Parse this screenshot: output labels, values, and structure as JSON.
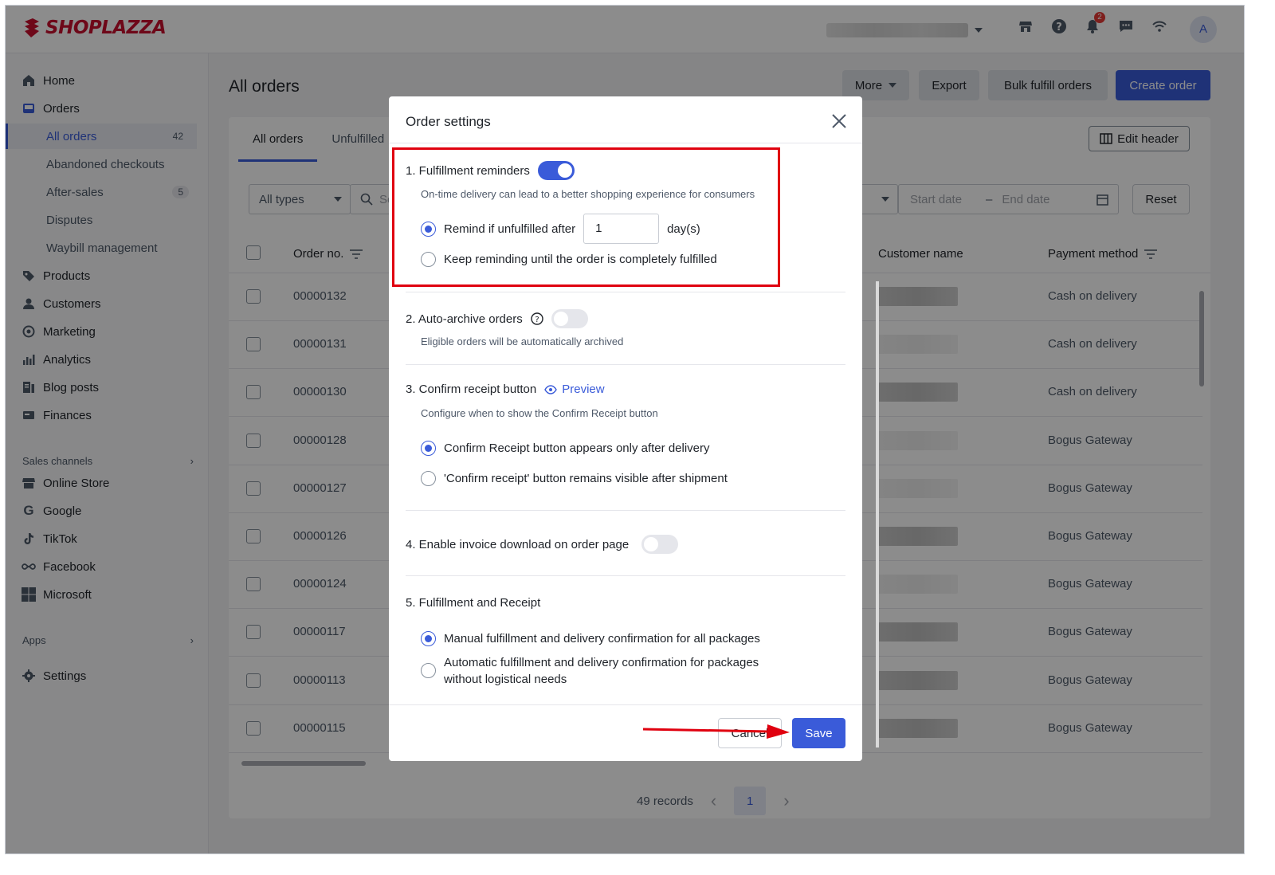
{
  "brand": {
    "name": "SHOPLAZZA",
    "color": "#c8102e"
  },
  "topbar": {
    "notification_count": "2",
    "avatar_initial": "A"
  },
  "sidebar": {
    "items": [
      {
        "label": "Home",
        "icon": "home-icon"
      },
      {
        "label": "Orders",
        "icon": "orders-icon"
      },
      {
        "label": "Products",
        "icon": "tag-icon"
      },
      {
        "label": "Customers",
        "icon": "person-icon"
      },
      {
        "label": "Marketing",
        "icon": "marketing-icon"
      },
      {
        "label": "Analytics",
        "icon": "bar-chart-icon"
      },
      {
        "label": "Blog posts",
        "icon": "blog-icon"
      },
      {
        "label": "Finances",
        "icon": "finances-icon"
      }
    ],
    "order_subitems": [
      {
        "label": "All orders",
        "count": "42",
        "active": true
      },
      {
        "label": "Abandoned checkouts",
        "count": ""
      },
      {
        "label": "After-sales",
        "count": "5"
      },
      {
        "label": "Disputes",
        "count": ""
      },
      {
        "label": "Waybill management",
        "count": ""
      }
    ],
    "sales_channels_label": "Sales channels",
    "channels": [
      {
        "label": "Online Store",
        "icon": "store-icon"
      },
      {
        "label": "Google",
        "icon": "google-icon"
      },
      {
        "label": "TikTok",
        "icon": "tiktok-icon"
      },
      {
        "label": "Facebook",
        "icon": "facebook-icon"
      },
      {
        "label": "Microsoft",
        "icon": "microsoft-icon"
      }
    ],
    "apps_label": "Apps",
    "settings_label": "Settings"
  },
  "main": {
    "title": "All orders",
    "actions": {
      "more": "More",
      "export": "Export",
      "bulk": "Bulk fulfill orders",
      "create": "Create order"
    },
    "tabs": [
      "All orders",
      "Unfulfilled"
    ],
    "edit_header": "Edit header",
    "filters": {
      "type": "All types",
      "search_placeholder": "Se",
      "start_date": "Start date",
      "end_date": "End date",
      "reset": "Reset"
    },
    "columns": {
      "order_no": "Order no.",
      "customer": "Customer name",
      "payment": "Payment method"
    },
    "rows": [
      {
        "order_no": "00000132",
        "payment": "Cash on delivery"
      },
      {
        "order_no": "00000131",
        "payment": "Cash on delivery"
      },
      {
        "order_no": "00000130",
        "payment": "Cash on delivery"
      },
      {
        "order_no": "00000128",
        "payment": "Bogus Gateway"
      },
      {
        "order_no": "00000127",
        "payment": "Bogus Gateway"
      },
      {
        "order_no": "00000126",
        "payment": "Bogus Gateway"
      },
      {
        "order_no": "00000124",
        "payment": "Bogus Gateway"
      },
      {
        "order_no": "00000117",
        "payment": "Bogus Gateway"
      },
      {
        "order_no": "00000113",
        "payment": "Bogus Gateway"
      },
      {
        "order_no": "00000115",
        "payment": "Bogus Gateway"
      }
    ],
    "pagination": {
      "records": "49 records",
      "page": "1"
    }
  },
  "modal": {
    "title": "Order settings",
    "sections": {
      "reminders": {
        "title": "1. Fulfillment reminders",
        "enabled": true,
        "desc": "On-time delivery can lead to a better shopping experience for consumers",
        "option1_prefix": "Remind if unfulfilled after",
        "days_value": "1",
        "option1_suffix": "day(s)",
        "option2": "Keep reminding until the order is completely fulfilled"
      },
      "archive": {
        "title": "2. Auto-archive orders",
        "enabled": false,
        "desc": "Eligible orders will be automatically archived"
      },
      "confirm": {
        "title": "3. Confirm receipt button",
        "preview": "Preview",
        "desc": "Configure when to show the Confirm Receipt button",
        "option1": "Confirm Receipt button appears only after delivery",
        "option2": "'Confirm receipt' button remains visible after shipment"
      },
      "invoice": {
        "title": "4. Enable invoice download on order page",
        "enabled": false
      },
      "fulfillment": {
        "title": "5. Fulfillment and Receipt",
        "option1": "Manual fulfillment and delivery confirmation for all packages",
        "option2": "Automatic fulfillment and delivery confirmation for packages without logistical needs"
      }
    },
    "cancel": "Cancel",
    "save": "Save"
  },
  "colors": {
    "primary": "#3a5bd9",
    "highlight": "#e0000f"
  }
}
